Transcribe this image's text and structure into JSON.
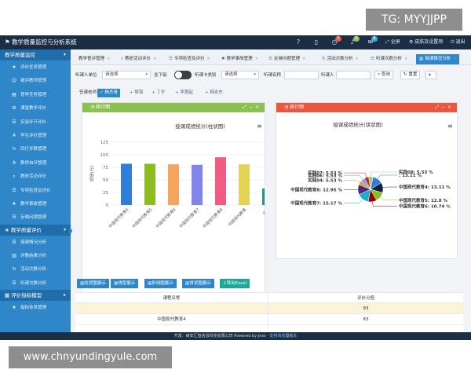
{
  "watermark_top": "TG: MYYJJPP",
  "watermark_bottom": "www.chnyundingyule.com",
  "app_title": "教学质量监控与分析系统",
  "topbar": {
    "badge_1": "2",
    "badge_2": "5",
    "badge_3": "6",
    "fullscreen_label": "全屏",
    "settings_label": "皮肤及设置项",
    "logout_label": "退出"
  },
  "sidebar": {
    "group_1": "教学质量监控",
    "group_1_items": [
      "评价任务管理",
      "被评教师管理",
      "督导任务管理",
      "课堂教学评价",
      "实验环节评价",
      "学生评价管理",
      "同行评教管理",
      "教师自评管理",
      "教研活动评价",
      "专项检查及评价",
      "教学事故管理",
      "反映问题管理"
    ],
    "group_2": "教学质量评价",
    "group_2_items": [
      "授课情况分析",
      "评教结果分析",
      "活动次数分析",
      "听课次数分析"
    ],
    "group_3": "评价指标模型",
    "group_3_items": [
      "指标体系管理"
    ]
  },
  "tabs": [
    {
      "label": "教学督评管理",
      "icon": ""
    },
    {
      "label": "教研活动评价",
      "icon": "search"
    },
    {
      "label": "专项检查及评价",
      "icon": "list"
    },
    {
      "label": "教学事故管理",
      "icon": "gear"
    },
    {
      "label": "反映问题管理",
      "icon": "list"
    },
    {
      "label": "活动次数分析",
      "icon": "refresh"
    },
    {
      "label": "听课次数分析",
      "icon": "list"
    },
    {
      "label": "授课情况分析",
      "icon": "chart"
    }
  ],
  "filter": {
    "dept_label": "听课人单位",
    "dept_value": "请选择",
    "sub_label": "含下级",
    "class_label": "听课卡类别",
    "class_value": "请选择",
    "name_label": "听课名称",
    "person_label": "听课人",
    "search_label": "查询",
    "reset_label": "重置"
  },
  "teacher_filter": {
    "label": "任课老师",
    "chips": [
      "杨杰清",
      "黎锦",
      "丁岁",
      "李惠起",
      "韩宏东"
    ]
  },
  "bar_panel": {
    "header": "统计图",
    "colors": {
      "header": "#8cc152"
    }
  },
  "pie_panel": {
    "header": "统计图",
    "colors": {
      "header": "#e9573f"
    }
  },
  "export_buttons": [
    "柱状图展示",
    "线型展示",
    "折线图展示",
    "饼状图展示",
    "导出Excel"
  ],
  "table": {
    "col_1": "课程名称",
    "col_2": "评价分值",
    "rows": [
      {
        "name": "",
        "score": "83"
      },
      {
        "name": "中国现代教育4",
        "score": "83"
      },
      {
        "name": "",
        "score": ""
      }
    ]
  },
  "footer": {
    "text": "开发：西安汇智信息科技有限公司 Powered by Jnss · ",
    "link": "支持浏览器版本"
  },
  "chart_data": [
    {
      "type": "bar",
      "title": "授课成绩统计(柱状图)",
      "ylabel": "成绩(分)",
      "categories": [
        "中国现代教育4",
        "中国现代教育5",
        "中国现代教育6",
        "中国现代教育7",
        "中国现代教育8",
        "中国现代教育",
        "实践"
      ],
      "values": [
        82,
        82,
        81,
        80,
        95,
        81,
        33
      ],
      "colors": [
        "#2f7ed8",
        "#8bbc21",
        "#f7a35c",
        "#8085e9",
        "#f15c80",
        "#e4d354",
        "#2b908f"
      ],
      "ylim": [
        0,
        125
      ],
      "yticks": [
        0,
        25,
        50,
        75,
        100,
        125
      ]
    },
    {
      "type": "pie",
      "title": "授课成绩统计(饼状图)",
      "slices": [
        {
          "label": "",
          "percent": 13.11,
          "color": "#2f7ed8"
        },
        {
          "label": "中国现代教育4",
          "percent": 13.11,
          "color": "#0d233a"
        },
        {
          "label": "中国现代教育5",
          "percent": 12.8,
          "color": "#8bbc21"
        },
        {
          "label": "中国现代教育6",
          "percent": 10.74,
          "color": "#910000"
        },
        {
          "label": "中国现代教育7",
          "percent": 15.17,
          "color": "#1aadce"
        },
        {
          "label": "中国现代教育8",
          "percent": 12.95,
          "color": "#492970"
        },
        {
          "label": "实践04",
          "percent": 5.53,
          "color": "#f28f43"
        },
        {
          "label": "实践06",
          "percent": 5.53,
          "color": "#77a1e5"
        },
        {
          "label": "实践07",
          "percent": 5.53,
          "color": "#c42525"
        },
        {
          "label": "实践08",
          "percent": 5.53,
          "color": "#a6c96a"
        }
      ]
    }
  ]
}
